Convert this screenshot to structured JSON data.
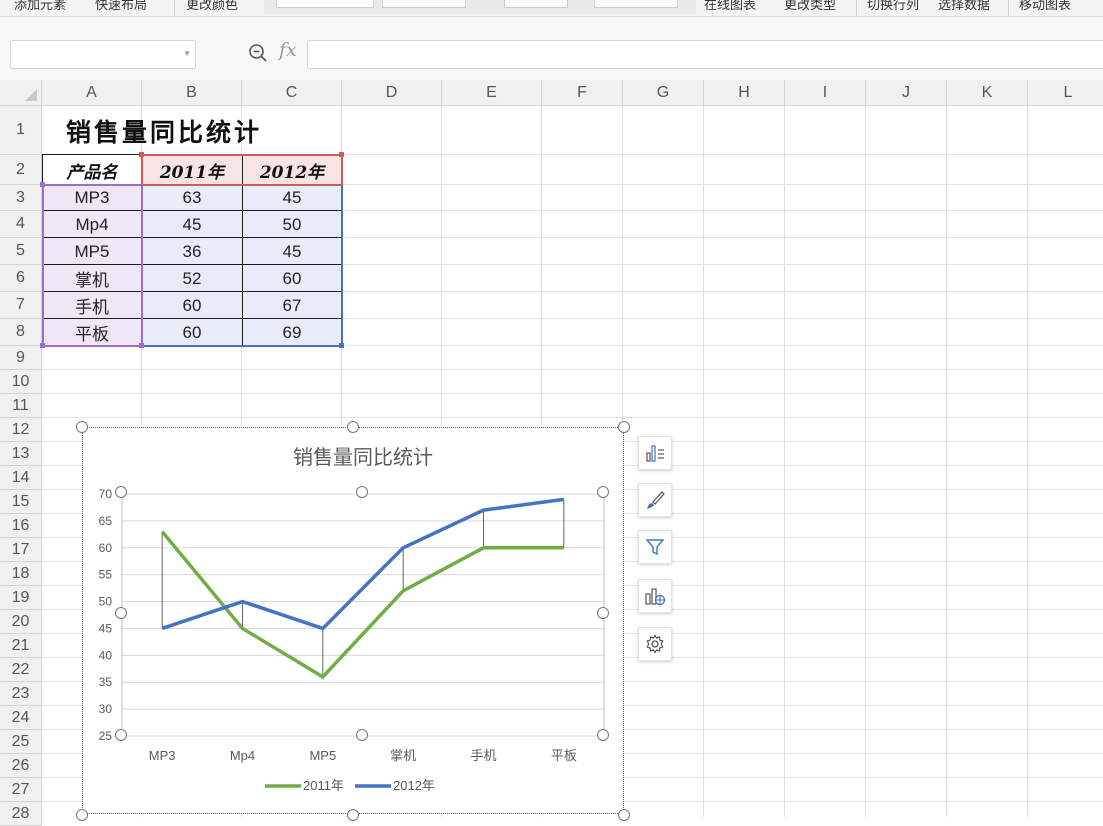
{
  "ribbon": {
    "items": [
      "添加元素",
      "快速布局",
      "更改颜色",
      "在线图表",
      "更改类型",
      "切换行列",
      "选择数据",
      "移动图表"
    ]
  },
  "formula_bar": {
    "name_box": "",
    "fx_label": "fx",
    "formula": ""
  },
  "columns": [
    "A",
    "B",
    "C",
    "D",
    "E",
    "F",
    "G",
    "H",
    "I",
    "J",
    "K",
    "L"
  ],
  "rows": [
    "1",
    "2",
    "3",
    "4",
    "5",
    "6",
    "7",
    "8",
    "9",
    "10",
    "11",
    "12",
    "13",
    "14",
    "15",
    "16",
    "17",
    "18",
    "19",
    "20",
    "21",
    "22",
    "23",
    "24",
    "25",
    "26",
    "27",
    "28"
  ],
  "sheet": {
    "title": "销售量同比统计",
    "headers": [
      "产品名",
      "2011年",
      "2012年"
    ],
    "data": [
      [
        "MP3",
        "63",
        "45"
      ],
      [
        "Mp4",
        "45",
        "50"
      ],
      [
        "MP5",
        "36",
        "45"
      ],
      [
        "掌机",
        "52",
        "60"
      ],
      [
        "手机",
        "60",
        "67"
      ],
      [
        "平板",
        "60",
        "69"
      ]
    ]
  },
  "colors": {
    "series_2011": "#70ad47",
    "series_2012": "#4472c4",
    "name_fill": "#efe6f6",
    "value_fill": "#e6ecf8",
    "year_header_fill": "#f7e4e4"
  },
  "chart_data": {
    "type": "line",
    "title": "销售量同比统计",
    "categories": [
      "MP3",
      "Mp4",
      "MP5",
      "掌机",
      "手机",
      "平板"
    ],
    "series": [
      {
        "name": "2011年",
        "values": [
          63,
          45,
          36,
          52,
          60,
          60
        ]
      },
      {
        "name": "2012年",
        "values": [
          45,
          50,
          45,
          60,
          67,
          69
        ]
      }
    ],
    "ylim": [
      25,
      70
    ],
    "yticks": [
      25,
      30,
      35,
      40,
      45,
      50,
      55,
      60,
      65,
      70
    ],
    "grid": true,
    "high_low_lines": true,
    "legend_position": "bottom"
  },
  "side_toolbar": [
    "chart-elements-icon",
    "chart-style-icon",
    "chart-filter-icon",
    "online-chart-icon",
    "chart-settings-icon"
  ]
}
